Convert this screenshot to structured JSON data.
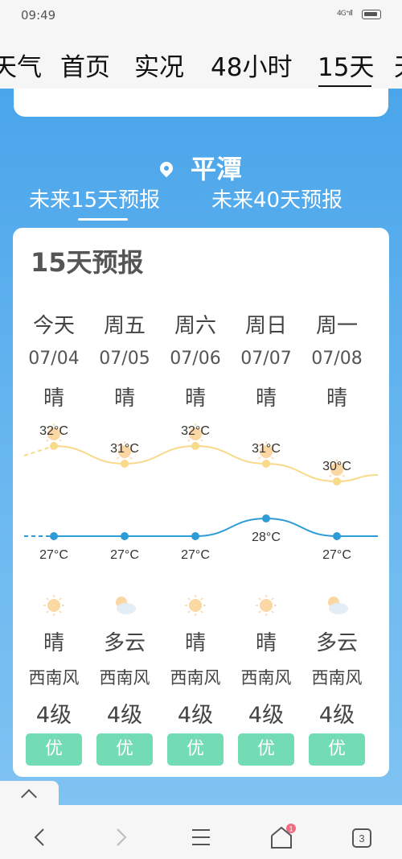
{
  "status": {
    "time": "09:49",
    "signal": "4G⁺ıll"
  },
  "nav": {
    "tabs": [
      "天气",
      "首页",
      "实况",
      "48小时",
      "15天",
      "天"
    ]
  },
  "header": {
    "city": "平潭",
    "subtabs": [
      "未来15天预报",
      "未来40天预报"
    ]
  },
  "forecast": {
    "title": "15天预报",
    "days": [
      {
        "day": "今天",
        "date": "07/04",
        "weather_day": "晴",
        "high": "32°C",
        "low": "27°C",
        "weather_night": "晴",
        "wind_dir": "西南风",
        "wind_level": "4级",
        "aqi": "优",
        "day_icon": "sun-icon",
        "night_icon": "sun-icon"
      },
      {
        "day": "周五",
        "date": "07/05",
        "weather_day": "晴",
        "high": "31°C",
        "low": "27°C",
        "weather_night": "多云",
        "wind_dir": "西南风",
        "wind_level": "4级",
        "aqi": "优",
        "day_icon": "sun-icon",
        "night_icon": "cloudy-icon"
      },
      {
        "day": "周六",
        "date": "07/06",
        "weather_day": "晴",
        "high": "32°C",
        "low": "27°C",
        "weather_night": "晴",
        "wind_dir": "西南风",
        "wind_level": "4级",
        "aqi": "优",
        "day_icon": "sun-icon",
        "night_icon": "sun-icon"
      },
      {
        "day": "周日",
        "date": "07/07",
        "weather_day": "晴",
        "high": "31°C",
        "low": "28°C",
        "weather_night": "晴",
        "wind_dir": "西南风",
        "wind_level": "4级",
        "aqi": "优",
        "day_icon": "sun-icon",
        "night_icon": "sun-icon"
      },
      {
        "day": "周一",
        "date": "07/08",
        "weather_day": "晴",
        "high": "30°C",
        "low": "27°C",
        "weather_night": "多云",
        "wind_dir": "西南风",
        "wind_level": "4级",
        "aqi": "优",
        "day_icon": "sun-icon",
        "night_icon": "cloudy-icon"
      }
    ]
  },
  "chart_data": {
    "type": "line",
    "categories": [
      "07/04",
      "07/05",
      "07/06",
      "07/07",
      "07/08"
    ],
    "series": [
      {
        "name": "",
        "values": [
          32,
          31,
          32,
          31,
          30
        ]
      },
      {
        "name": "",
        "values": [
          27,
          27,
          27,
          28,
          27
        ]
      }
    ],
    "units": "°C"
  },
  "bottom_nav": {
    "tab_count": "3",
    "notification_count": "1"
  },
  "colors": {
    "accent": "#4aa5ea",
    "high_line": "#f9d98a",
    "low_line": "#2d9bd6",
    "aqi_good": "#73dcb4"
  }
}
